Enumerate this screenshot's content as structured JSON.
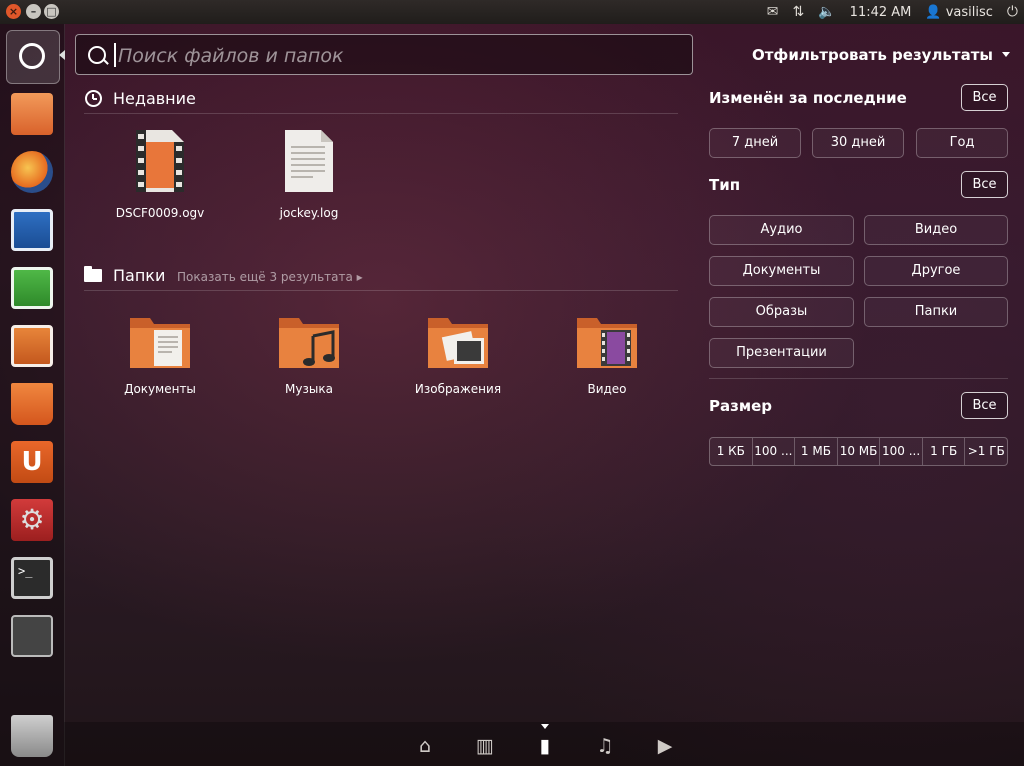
{
  "window_controls": {
    "close": "×",
    "minimize": "–",
    "maximize": "□"
  },
  "indicators": {
    "time": "11:42 AM",
    "user": "vasilisc"
  },
  "search": {
    "placeholder": "Поиск файлов и папок",
    "value": ""
  },
  "recent": {
    "title": "Недавние",
    "items": [
      {
        "label": "DSCF0009.ogv",
        "icon": "video-file-icon"
      },
      {
        "label": "jockey.log",
        "icon": "text-file-icon"
      }
    ]
  },
  "folders": {
    "title": "Папки",
    "more": "Показать ещё 3 результата",
    "items": [
      {
        "label": "Документы",
        "icon": "documents-folder-icon"
      },
      {
        "label": "Музыка",
        "icon": "music-folder-icon"
      },
      {
        "label": "Изображения",
        "icon": "pictures-folder-icon"
      },
      {
        "label": "Видео",
        "icon": "videos-folder-icon"
      }
    ]
  },
  "filters": {
    "title": "Отфильтровать результаты",
    "modified": {
      "title": "Изменён за последние",
      "all": "Все",
      "options": [
        "7 дней",
        "30 дней",
        "Год"
      ]
    },
    "type": {
      "title": "Тип",
      "all": "Все",
      "options": [
        "Аудио",
        "Видео",
        "Документы",
        "Другое",
        "Образы",
        "Папки",
        "Презентации"
      ]
    },
    "size": {
      "title": "Размер",
      "all": "Все",
      "options": [
        "1 КБ",
        "100 ...",
        "1 МБ",
        "10 МБ",
        "100 ...",
        "1 ГБ",
        ">1 ГБ"
      ]
    }
  },
  "lenses": [
    {
      "name": "home-lens-icon",
      "glyph": "⌂"
    },
    {
      "name": "applications-lens-icon",
      "glyph": "▥"
    },
    {
      "name": "files-lens-icon",
      "glyph": "▮"
    },
    {
      "name": "music-lens-icon",
      "glyph": "♫"
    },
    {
      "name": "video-lens-icon",
      "glyph": "▶"
    }
  ],
  "colors": {
    "accent": "#dd4814",
    "folder": "#e8763a",
    "panel": "#201d1b"
  }
}
